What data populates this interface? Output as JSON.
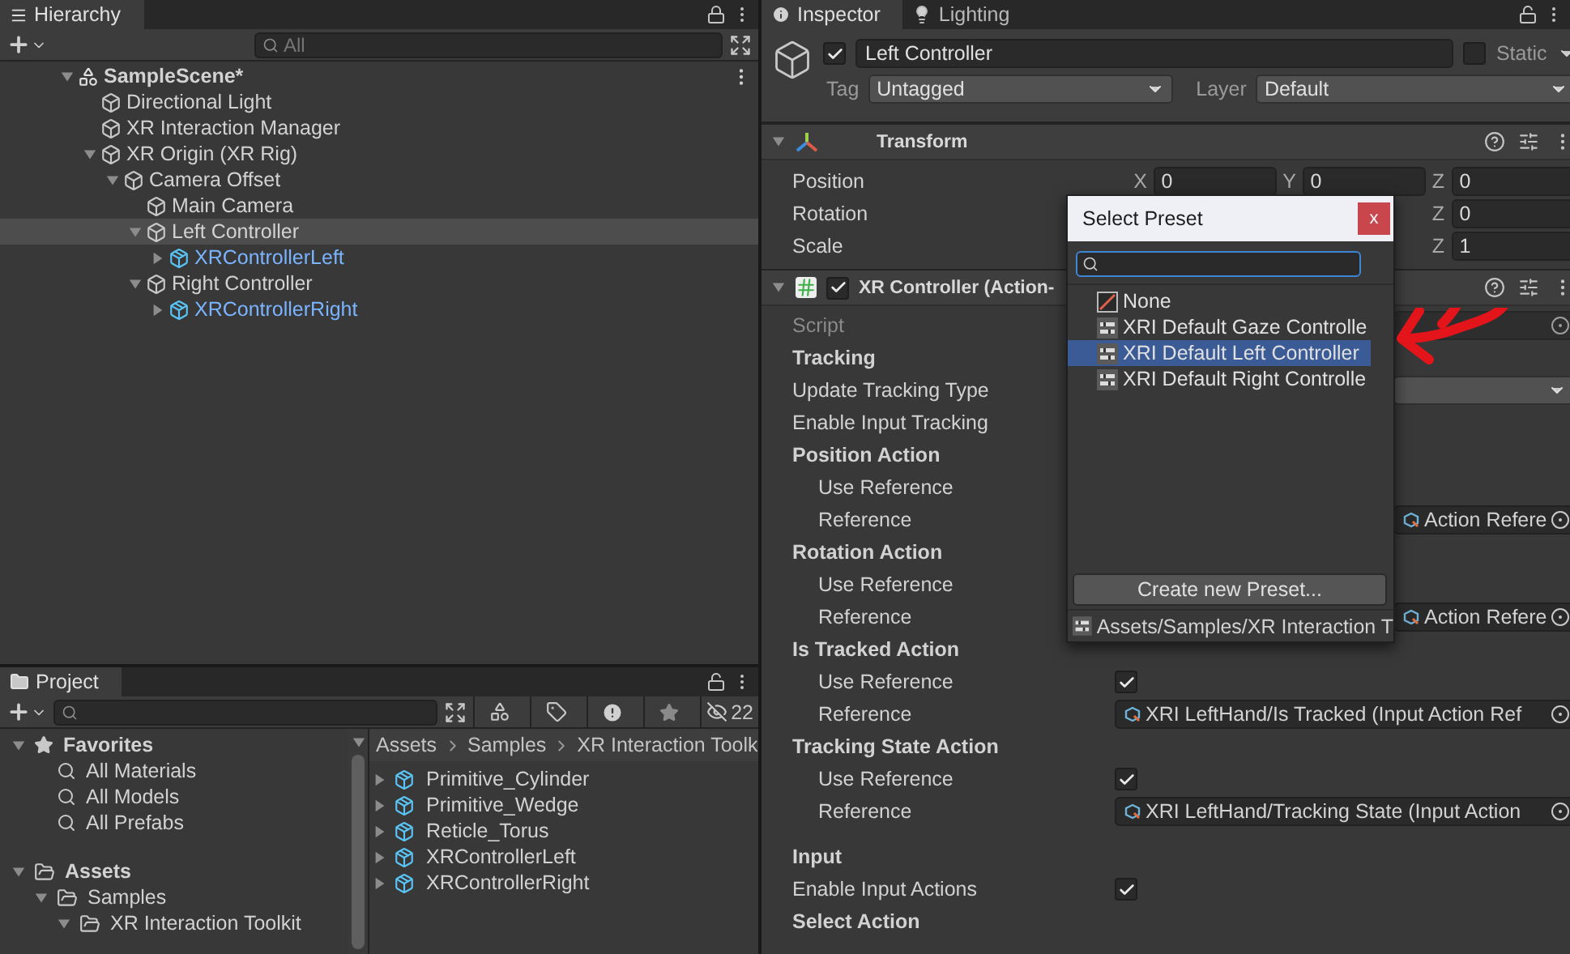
{
  "hierarchy": {
    "tab": "Hierarchy",
    "search": {
      "placeholder": "All"
    },
    "tree": [
      {
        "name": "SampleScene*",
        "kind": "scene",
        "expanded": true,
        "selected": false,
        "children": [
          {
            "name": "Directional Light",
            "kind": "object",
            "selected": false
          },
          {
            "name": "XR Interaction Manager",
            "kind": "object",
            "selected": false
          },
          {
            "name": "XR Origin (XR Rig)",
            "kind": "object",
            "expanded": true,
            "selected": false,
            "children": [
              {
                "name": "Camera Offset",
                "kind": "object",
                "expanded": true,
                "selected": false,
                "children": [
                  {
                    "name": "Main Camera",
                    "kind": "object",
                    "selected": false
                  },
                  {
                    "name": "Left Controller",
                    "kind": "object",
                    "expanded": true,
                    "selected": true,
                    "children": [
                      {
                        "name": "XRControllerLeft",
                        "kind": "prefab",
                        "expanded": false,
                        "selected": false
                      }
                    ]
                  },
                  {
                    "name": "Right Controller",
                    "kind": "object",
                    "expanded": true,
                    "selected": false,
                    "children": [
                      {
                        "name": "XRControllerRight",
                        "kind": "prefab",
                        "expanded": false,
                        "selected": false
                      }
                    ]
                  }
                ]
              }
            ]
          }
        ]
      }
    ]
  },
  "project": {
    "tab": "Project",
    "hidden_count": "22",
    "tree": [
      {
        "name": "Favorites",
        "kind": "favorites",
        "expanded": true,
        "children": [
          {
            "name": "All Materials",
            "kind": "search"
          },
          {
            "name": "All Models",
            "kind": "search"
          },
          {
            "name": "All Prefabs",
            "kind": "search"
          }
        ]
      },
      {
        "name": "Assets",
        "kind": "folder",
        "expanded": true,
        "children": [
          {
            "name": "Samples",
            "kind": "folder",
            "expanded": true,
            "children": [
              {
                "name": "XR Interaction Toolkit",
                "kind": "folder",
                "expanded": true
              }
            ]
          }
        ]
      }
    ],
    "breadcrumb": [
      "Assets",
      "Samples",
      "XR Interaction Toolk"
    ],
    "items": [
      {
        "name": "Primitive_Cylinder"
      },
      {
        "name": "Primitive_Wedge"
      },
      {
        "name": "Reticle_Torus"
      },
      {
        "name": "XRControllerLeft"
      },
      {
        "name": "XRControllerRight"
      }
    ]
  },
  "inspector": {
    "tabs": [
      {
        "label": "Inspector",
        "selected": true
      },
      {
        "label": "Lighting",
        "selected": false
      }
    ],
    "object": {
      "active": true,
      "name": "Left Controller",
      "static": false,
      "static_label": "Static",
      "tag_label": "Tag",
      "tag": "Untagged",
      "layer_label": "Layer",
      "layer": "Default"
    },
    "transform": {
      "title": "Transform",
      "expanded": true,
      "rows": [
        {
          "label": "Position",
          "fields": [
            {
              "axis": "X",
              "value": "0"
            },
            {
              "axis": "Y",
              "value": "0"
            },
            {
              "axis": "Z",
              "value": "0"
            }
          ]
        },
        {
          "label": "Rotation",
          "fields": [
            {
              "axis": "Z",
              "value": "0"
            }
          ]
        },
        {
          "label": "Scale",
          "fields": [
            {
              "axis": "Z",
              "value": "1"
            }
          ]
        }
      ]
    },
    "component": {
      "title": "XR Controller (Action-",
      "enabled": true,
      "expanded": true,
      "rows": [
        {
          "kind": "object",
          "label": "Script",
          "disabled": true
        },
        {
          "kind": "heading",
          "label": "Tracking"
        },
        {
          "kind": "dropdown",
          "label": "Update Tracking Type"
        },
        {
          "kind": "label",
          "label": "Enable Input Tracking"
        },
        {
          "kind": "group",
          "label": "Position Action",
          "children": [
            {
              "kind": "label",
              "label": "Use Reference"
            },
            {
              "kind": "object",
              "label": "Reference",
              "value": "Action Refere"
            }
          ]
        },
        {
          "kind": "group",
          "label": "Rotation Action",
          "children": [
            {
              "kind": "label",
              "label": "Use Reference"
            },
            {
              "kind": "object",
              "label": "Reference",
              "value": "Action Refere"
            }
          ]
        },
        {
          "kind": "group",
          "label": "Is Tracked Action",
          "children": [
            {
              "kind": "check",
              "label": "Use Reference",
              "checked": true
            },
            {
              "kind": "object",
              "label": "Reference",
              "value": "XRI LeftHand/Is Tracked (Input Action Ref"
            }
          ]
        },
        {
          "kind": "group",
          "label": "Tracking State Action",
          "children": [
            {
              "kind": "check",
              "label": "Use Reference",
              "checked": true
            },
            {
              "kind": "object",
              "label": "Reference",
              "value": "XRI LeftHand/Tracking State (Input Action"
            }
          ]
        },
        {
          "kind": "heading",
          "label": "Input"
        },
        {
          "kind": "check",
          "label": "Enable Input Actions",
          "checked": true
        },
        {
          "kind": "group",
          "label": "Select Action"
        }
      ]
    }
  },
  "popup": {
    "title": "Select Preset",
    "close": "x",
    "items": [
      {
        "name": "None",
        "kind": "none",
        "selected": false
      },
      {
        "name": "XRI Default Gaze Controlle",
        "kind": "preset",
        "selected": false
      },
      {
        "name": "XRI Default Left Controller",
        "kind": "preset",
        "selected": true
      },
      {
        "name": "XRI Default Right Controlle",
        "kind": "preset",
        "selected": false
      }
    ],
    "create_button": "Create new Preset...",
    "path": "Assets/Samples/XR Interaction T"
  }
}
